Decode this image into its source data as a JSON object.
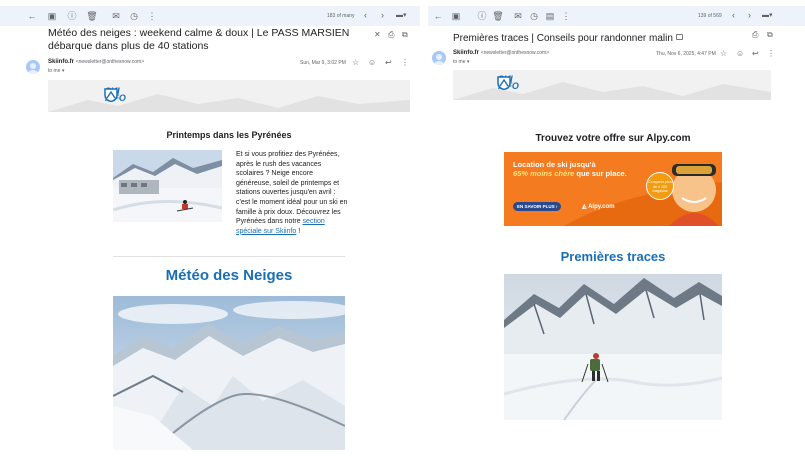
{
  "left": {
    "message_count": "183 of many",
    "subject": "Météo des neiges : weekend calme & doux | Le PASS MARSIEN débarque dans plus de 40 stations",
    "sender_name": "Skiinfo.fr",
    "sender_email": "<newsletter@onthesnow.com>",
    "to": "to me",
    "date": "Sun, Mar 9, 3:02 PM",
    "logo_line1": "SKI",
    "logo_line2": "INFO",
    "section1_title": "Printemps dans les Pyrénées",
    "section1_text": "Et si vous profitiez des Pyrénées, après le rush des vacances scolaires ? Neige encore généreuse, soleil de printemps et stations ouvertes jusqu'en avril : c'est le moment idéal pour un ski en famille à prix doux. Découvrez les Pyrénées dans notre ",
    "section1_link": "section spéciale sur Skiinfo",
    "section1_after": " !",
    "section2_title": "Météo des Neiges"
  },
  "right": {
    "message_count": "139 of 569",
    "subject": "Premières traces | Conseils pour randonner malin",
    "sender_name": "Skiinfo.fr",
    "sender_email": "<newsletter@onthesnow.com>",
    "to": "to me",
    "date": "Thu, Nov 6, 2025, 4:47 PM",
    "logo_line1": "SKI",
    "logo_line2": "INFO",
    "offer_title": "Trouvez votre offre sur Alpy.com",
    "ad": {
      "line1": "Location de ski jusqu'à",
      "highlight": "65% moins chère",
      "line2_rest": " que sur place.",
      "button": "EN SAVOIR PLUS ›",
      "brand": "Alpy.com",
      "badge": "Comparez plus de 4 100 magasins"
    },
    "section_title": "Premières traces"
  },
  "colors": {
    "toolbar_bg": "#eef3fb",
    "brand_blue": "#1a6fb4",
    "ad_orange": "#f47b20",
    "ad_button": "#2a4a8f"
  }
}
